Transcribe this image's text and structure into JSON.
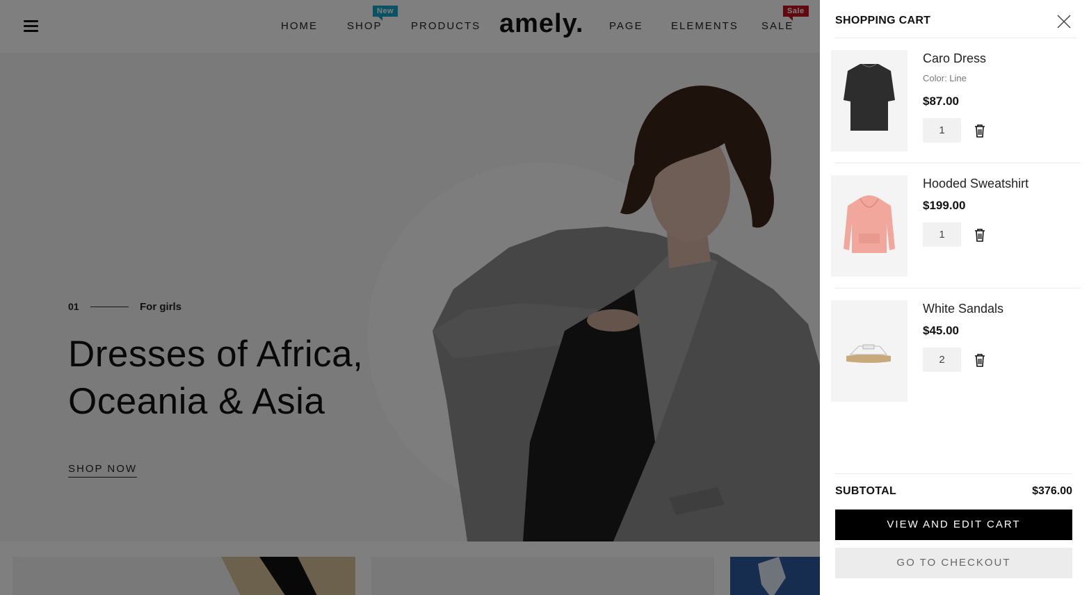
{
  "header": {
    "logo": "amely.",
    "nav": [
      "HOME",
      "SHOP",
      "PRODUCTS",
      "PAGE",
      "ELEMENTS",
      "SALE"
    ],
    "badges": {
      "shop": "New",
      "sale": "Sale"
    }
  },
  "hero": {
    "slide_number": "01",
    "subtitle": "For girls",
    "title_line1": "Dresses of Africa,",
    "title_line2": "Oceania & Asia",
    "cta": "SHOP NOW"
  },
  "cart": {
    "title": "SHOPPING CART",
    "items": [
      {
        "name": "Caro Dress",
        "color": "Color: Line",
        "price": "$87.00",
        "qty": "1",
        "image_icon": "dress-image"
      },
      {
        "name": "Hooded Sweatshirt",
        "price": "$199.00",
        "qty": "1",
        "image_icon": "sweatshirt-image"
      },
      {
        "name": "White Sandals",
        "price": "$45.00",
        "qty": "2",
        "image_icon": "sandals-image"
      }
    ],
    "subtotal_label": "SUBTOTAL",
    "subtotal_value": "$376.00",
    "view_cart_label": "VIEW AND EDIT CART",
    "checkout_label": "GO TO CHECKOUT"
  },
  "colors": {
    "badge_new": "#1aa5c9",
    "badge_sale": "#c1121f",
    "primary_button": "#000000",
    "overlay": "rgba(0,0,0,0.5)"
  }
}
